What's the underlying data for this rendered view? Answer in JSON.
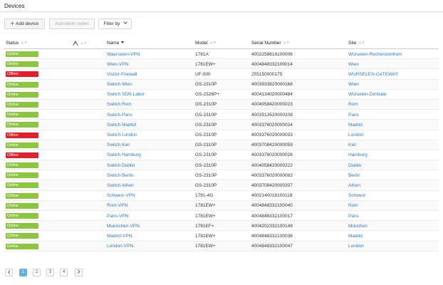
{
  "header": {
    "title": "Devices"
  },
  "toolbar": {
    "add_label": "Add device",
    "activation_label": "Activation codes",
    "filter_label": "Filter by"
  },
  "columns": {
    "status": "Status",
    "name": "Name",
    "model": "Model",
    "serial": "Serial Number",
    "site": "Site"
  },
  "colors": {
    "online": "#8cc63f",
    "offline": "#e0202a",
    "link": "#2b7bc4",
    "active_page": "#5ab4e8"
  },
  "rows": [
    {
      "status": "Online",
      "name": "Waerselen-VPN",
      "model": "1781A",
      "serial": "4002258818100006",
      "site": "Würselen-Rechenzentrum"
    },
    {
      "status": "Online",
      "name": "Wien-VPN",
      "model": "1781EW+",
      "serial": "4004848332100014",
      "site": "Wien"
    },
    {
      "status": "Offline",
      "name": "Visitor-Firewall",
      "model": "UF-500",
      "serial": "255150000175",
      "site": "WURSELEN-GATEWAY"
    },
    {
      "status": "Online",
      "name": "Switch Wien",
      "model": "GS-2310P",
      "serial": "4003933820000168",
      "site": "Wien"
    },
    {
      "status": "Online",
      "name": "Switch SDN Labor",
      "model": "GS-2326P+",
      "serial": "4004134020000484",
      "site": "Würselen-Zentrale"
    },
    {
      "status": "Online",
      "name": "Switch Rom",
      "model": "GS-2310P",
      "serial": "4004058420000023",
      "site": "Rom"
    },
    {
      "status": "Online",
      "name": "Switch Paris",
      "model": "GS-2310P",
      "serial": "4003513520000208",
      "site": "Paris"
    },
    {
      "status": "Online",
      "name": "Switch Madrid",
      "model": "GS-2310P",
      "serial": "4003376020000024",
      "site": "Madrid"
    },
    {
      "status": "Offline",
      "name": "Switch London",
      "model": "GS-2310P",
      "serial": "4003376020000033",
      "site": "London"
    },
    {
      "status": "Online",
      "name": "Switch Kiel",
      "model": "GS-2310P",
      "serial": "4003708420000059",
      "site": "Kiel"
    },
    {
      "status": "Offline",
      "name": "Switch Hamburg",
      "model": "GS-2310P",
      "serial": "4003376020000026",
      "site": "Hamburg"
    },
    {
      "status": "Online",
      "name": "Switch Dublin",
      "model": "GS-2310P",
      "serial": "4004058420000222",
      "site": "Dublin"
    },
    {
      "status": "Online",
      "name": "Switch Berlin",
      "model": "GS-2310P",
      "serial": "4003376020000083",
      "site": "Berlin"
    },
    {
      "status": "Online",
      "name": "Switch Athen",
      "model": "GS-2310P",
      "serial": "4003708420000207",
      "site": "Athen"
    },
    {
      "status": "Online",
      "name": "Schweiz-VPN",
      "model": "1781-4G",
      "serial": "4002140018100118",
      "site": "Schweiz"
    },
    {
      "status": "Online",
      "name": "Rom-VPN",
      "model": "1781EW+",
      "serial": "4004848332100040",
      "site": "Rom"
    },
    {
      "status": "Online",
      "name": "Paris-VPN",
      "model": "1781EW+",
      "serial": "4004848332100017",
      "site": "Paris"
    },
    {
      "status": "Online",
      "name": "Muenchen-VPN",
      "model": "1781EF+",
      "serial": "4004202332100149",
      "site": "München"
    },
    {
      "status": "Online",
      "name": "Madrid-VPN",
      "model": "1781EW+",
      "serial": "4004848332100038",
      "site": "Madrid"
    },
    {
      "status": "Online",
      "name": "London-VPN",
      "model": "1781EW+",
      "serial": "4004848332100047",
      "site": "London"
    }
  ],
  "pagination": {
    "pages": [
      "1",
      "2",
      "3",
      "4"
    ],
    "current": "1"
  }
}
